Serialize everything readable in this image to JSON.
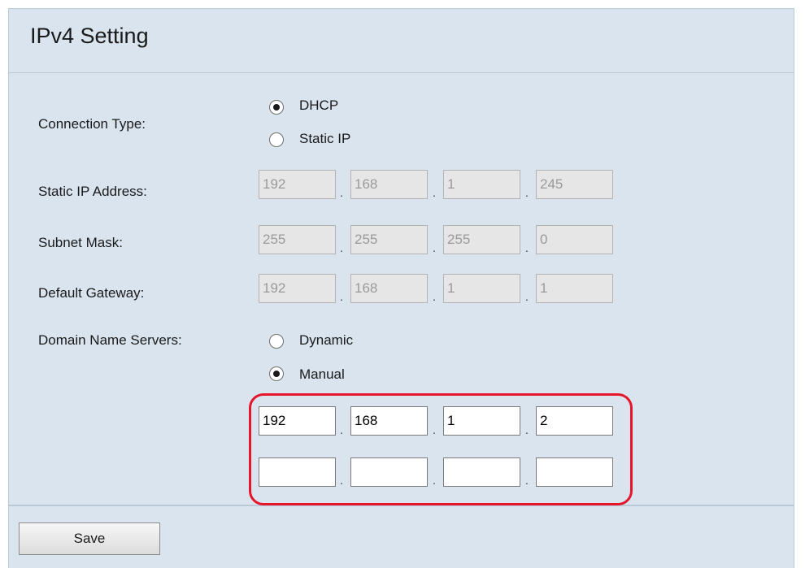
{
  "page_title": "IPv4 Setting",
  "connection_type": {
    "label": "Connection Type:",
    "options": [
      {
        "label": "DHCP",
        "selected": true
      },
      {
        "label": "Static IP",
        "selected": false
      }
    ]
  },
  "static_ip": {
    "label": "Static IP Address:",
    "octets": [
      "192",
      "168",
      "1",
      "245"
    ]
  },
  "subnet_mask": {
    "label": "Subnet Mask:",
    "octets": [
      "255",
      "255",
      "255",
      "0"
    ]
  },
  "default_gateway": {
    "label": "Default Gateway:",
    "octets": [
      "192",
      "168",
      "1",
      "1"
    ]
  },
  "dns": {
    "label": "Domain Name Servers:",
    "options": [
      {
        "label": "Dynamic",
        "selected": false
      },
      {
        "label": "Manual",
        "selected": true
      }
    ],
    "primary": [
      "192",
      "168",
      "1",
      "2"
    ],
    "secondary": [
      "",
      "",
      "",
      ""
    ]
  },
  "separator": ".",
  "save_label": "Save",
  "colors": {
    "panel_bg": "#d9e4ef",
    "highlight": "#e5162a"
  }
}
